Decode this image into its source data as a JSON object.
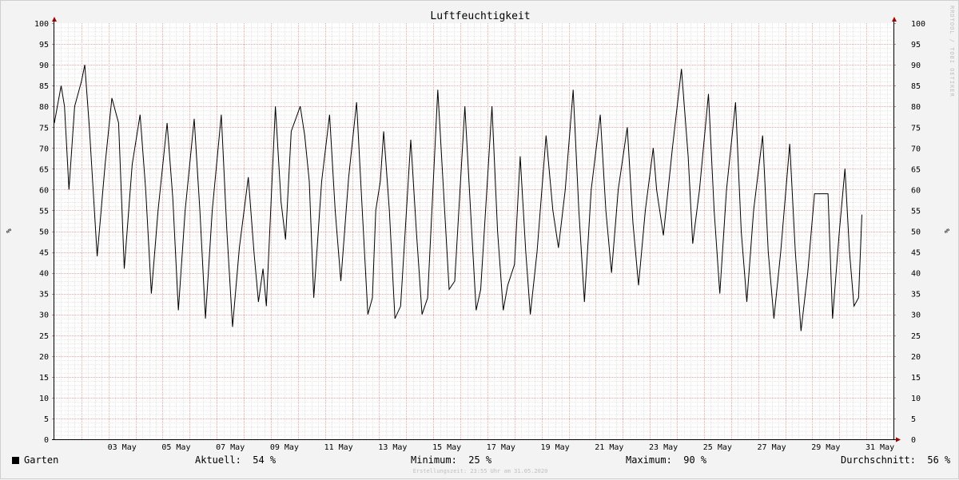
{
  "chart_data": {
    "type": "line",
    "title": "Luftfeuchtigkeit",
    "ylabel": "%",
    "ylim": [
      0,
      100
    ],
    "yticks": [
      0,
      5,
      10,
      15,
      20,
      25,
      30,
      35,
      40,
      45,
      50,
      55,
      60,
      65,
      70,
      75,
      80,
      85,
      90,
      95,
      100
    ],
    "xlim": [
      "2020-05-01",
      "2020-06-01"
    ],
    "xtick_labels": [
      {
        "x": "2020-05-03",
        "label": "03 May"
      },
      {
        "x": "2020-05-05",
        "label": "05 May"
      },
      {
        "x": "2020-05-07",
        "label": "07 May"
      },
      {
        "x": "2020-05-09",
        "label": "09 May"
      },
      {
        "x": "2020-05-11",
        "label": "11 May"
      },
      {
        "x": "2020-05-13",
        "label": "13 May"
      },
      {
        "x": "2020-05-15",
        "label": "15 May"
      },
      {
        "x": "2020-05-17",
        "label": "17 May"
      },
      {
        "x": "2020-05-19",
        "label": "19 May"
      },
      {
        "x": "2020-05-21",
        "label": "21 May"
      },
      {
        "x": "2020-05-23",
        "label": "23 May"
      },
      {
        "x": "2020-05-25",
        "label": "25 May"
      },
      {
        "x": "2020-05-27",
        "label": "27 May"
      },
      {
        "x": "2020-05-29",
        "label": "29 May"
      },
      {
        "x": "2020-05-31",
        "label": "31 May"
      }
    ],
    "grid": true,
    "series": [
      {
        "name": "Garten",
        "color": "#000000",
        "points": [
          [
            "2020-05-01 00:00",
            76
          ],
          [
            "2020-05-01 06:00",
            85
          ],
          [
            "2020-05-01 09:00",
            80
          ],
          [
            "2020-05-01 13:00",
            60
          ],
          [
            "2020-05-01 18:00",
            80
          ],
          [
            "2020-05-02 00:00",
            86
          ],
          [
            "2020-05-02 03:00",
            90
          ],
          [
            "2020-05-02 07:00",
            75
          ],
          [
            "2020-05-02 14:00",
            44
          ],
          [
            "2020-05-02 21:00",
            66
          ],
          [
            "2020-05-03 03:00",
            82
          ],
          [
            "2020-05-03 09:00",
            76
          ],
          [
            "2020-05-03 14:00",
            41
          ],
          [
            "2020-05-03 21:00",
            66
          ],
          [
            "2020-05-04 04:00",
            78
          ],
          [
            "2020-05-04 09:00",
            60
          ],
          [
            "2020-05-04 14:00",
            35
          ],
          [
            "2020-05-04 20:00",
            55
          ],
          [
            "2020-05-05 04:00",
            76
          ],
          [
            "2020-05-05 09:00",
            58
          ],
          [
            "2020-05-05 14:00",
            31
          ],
          [
            "2020-05-05 20:00",
            55
          ],
          [
            "2020-05-06 04:00",
            77
          ],
          [
            "2020-05-06 09:00",
            55
          ],
          [
            "2020-05-06 14:00",
            29
          ],
          [
            "2020-05-06 20:00",
            55
          ],
          [
            "2020-05-07 04:00",
            78
          ],
          [
            "2020-05-07 09:00",
            50
          ],
          [
            "2020-05-07 14:00",
            27
          ],
          [
            "2020-05-07 20:00",
            46
          ],
          [
            "2020-05-08 04:00",
            63
          ],
          [
            "2020-05-08 09:00",
            45
          ],
          [
            "2020-05-08 13:00",
            33
          ],
          [
            "2020-05-08 17:00",
            41
          ],
          [
            "2020-05-08 20:00",
            32
          ],
          [
            "2020-05-09 04:00",
            80
          ],
          [
            "2020-05-09 09:00",
            57
          ],
          [
            "2020-05-09 13:00",
            48
          ],
          [
            "2020-05-09 18:00",
            74
          ],
          [
            "2020-05-10 02:00",
            80
          ],
          [
            "2020-05-10 06:00",
            73
          ],
          [
            "2020-05-10 10:00",
            62
          ],
          [
            "2020-05-10 14:00",
            34
          ],
          [
            "2020-05-10 21:00",
            62
          ],
          [
            "2020-05-11 04:00",
            78
          ],
          [
            "2020-05-11 09:00",
            55
          ],
          [
            "2020-05-11 14:00",
            38
          ],
          [
            "2020-05-11 21:00",
            63
          ],
          [
            "2020-05-12 04:00",
            81
          ],
          [
            "2020-05-12 09:00",
            55
          ],
          [
            "2020-05-12 14:00",
            30
          ],
          [
            "2020-05-12 18:00",
            34
          ],
          [
            "2020-05-12 21:00",
            55
          ],
          [
            "2020-05-13 01:00",
            62
          ],
          [
            "2020-05-13 04:00",
            74
          ],
          [
            "2020-05-13 09:00",
            55
          ],
          [
            "2020-05-13 14:00",
            29
          ],
          [
            "2020-05-13 19:00",
            32
          ],
          [
            "2020-05-14 04:00",
            72
          ],
          [
            "2020-05-14 09:00",
            50
          ],
          [
            "2020-05-14 14:00",
            30
          ],
          [
            "2020-05-14 19:00",
            34
          ],
          [
            "2020-05-15 04:00",
            84
          ],
          [
            "2020-05-15 09:00",
            60
          ],
          [
            "2020-05-15 14:00",
            36
          ],
          [
            "2020-05-15 19:00",
            38
          ],
          [
            "2020-05-16 04:00",
            80
          ],
          [
            "2020-05-16 09:00",
            55
          ],
          [
            "2020-05-16 14:00",
            31
          ],
          [
            "2020-05-16 18:00",
            36
          ],
          [
            "2020-05-17 04:00",
            80
          ],
          [
            "2020-05-17 09:00",
            50
          ],
          [
            "2020-05-17 14:00",
            31
          ],
          [
            "2020-05-17 18:00",
            37
          ],
          [
            "2020-05-18 00:00",
            42
          ],
          [
            "2020-05-18 05:00",
            68
          ],
          [
            "2020-05-18 10:00",
            45
          ],
          [
            "2020-05-18 14:00",
            30
          ],
          [
            "2020-05-18 20:00",
            45
          ],
          [
            "2020-05-19 04:00",
            73
          ],
          [
            "2020-05-19 10:00",
            55
          ],
          [
            "2020-05-19 15:00",
            46
          ],
          [
            "2020-05-19 21:00",
            60
          ],
          [
            "2020-05-20 04:00",
            84
          ],
          [
            "2020-05-20 09:00",
            55
          ],
          [
            "2020-05-20 14:00",
            33
          ],
          [
            "2020-05-20 20:00",
            60
          ],
          [
            "2020-05-21 04:00",
            78
          ],
          [
            "2020-05-21 09:00",
            55
          ],
          [
            "2020-05-21 14:00",
            40
          ],
          [
            "2020-05-21 20:00",
            60
          ],
          [
            "2020-05-22 04:00",
            75
          ],
          [
            "2020-05-22 09:00",
            52
          ],
          [
            "2020-05-22 14:00",
            37
          ],
          [
            "2020-05-22 20:00",
            55
          ],
          [
            "2020-05-23 03:00",
            70
          ],
          [
            "2020-05-23 06:00",
            60
          ],
          [
            "2020-05-23 12:00",
            49
          ],
          [
            "2020-05-23 20:00",
            70
          ],
          [
            "2020-05-24 04:00",
            89
          ],
          [
            "2020-05-24 10:00",
            68
          ],
          [
            "2020-05-24 14:00",
            47
          ],
          [
            "2020-05-24 20:00",
            60
          ],
          [
            "2020-05-25 04:00",
            83
          ],
          [
            "2020-05-25 09:00",
            55
          ],
          [
            "2020-05-25 14:00",
            35
          ],
          [
            "2020-05-25 20:00",
            60
          ],
          [
            "2020-05-26 04:00",
            81
          ],
          [
            "2020-05-26 09:00",
            50
          ],
          [
            "2020-05-26 14:00",
            33
          ],
          [
            "2020-05-26 20:00",
            55
          ],
          [
            "2020-05-27 04:00",
            73
          ],
          [
            "2020-05-27 09:00",
            45
          ],
          [
            "2020-05-27 14:00",
            29
          ],
          [
            "2020-05-27 20:00",
            45
          ],
          [
            "2020-05-28 04:00",
            71
          ],
          [
            "2020-05-28 09:00",
            45
          ],
          [
            "2020-05-28 14:00",
            26
          ],
          [
            "2020-05-28 20:00",
            40
          ],
          [
            "2020-05-29 02:00",
            59
          ],
          [
            "2020-05-29 14:00",
            59
          ],
          [
            "2020-05-29 18:00",
            29
          ],
          [
            "2020-05-30 00:00",
            50
          ],
          [
            "2020-05-30 05:00",
            65
          ],
          [
            "2020-05-30 09:00",
            45
          ],
          [
            "2020-05-30 13:00",
            32
          ],
          [
            "2020-05-30 17:00",
            34
          ],
          [
            "2020-05-30 20:00",
            54
          ]
        ]
      }
    ]
  },
  "legend": {
    "series_label": "Garten",
    "current_label": "Aktuell:",
    "current_value": "54 %",
    "min_label": "Minimum:",
    "min_value": "25 %",
    "max_label": "Maximum:",
    "max_value": "90 %",
    "avg_label": "Durchschnitt:",
    "avg_value": "56 %"
  },
  "footer": "Erstellungszeit: 23:55 Uhr am 31.05.2020",
  "watermark": "RRDTOOL / TOBI OETIKER"
}
